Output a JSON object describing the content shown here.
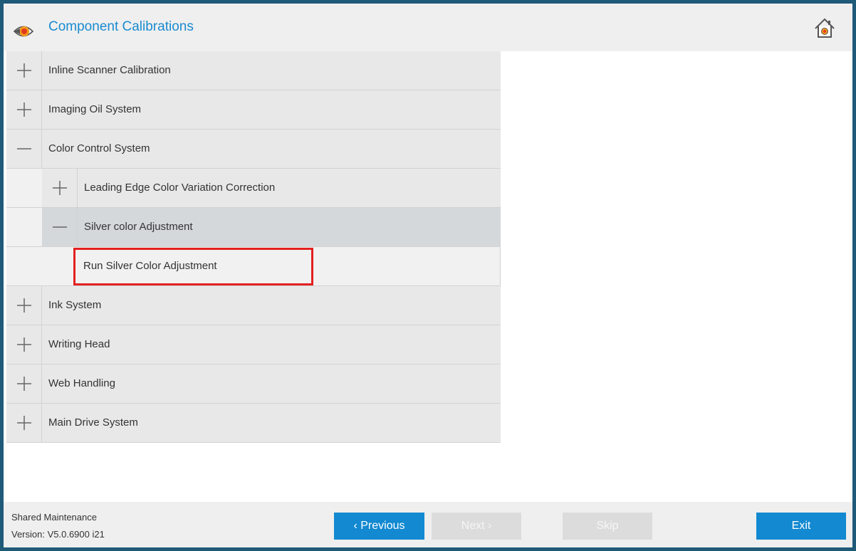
{
  "header": {
    "title": "Component Calibrations",
    "app_icon": "eye-icon",
    "home_icon": "home-icon"
  },
  "tree": {
    "items": [
      {
        "label": "Inline Scanner Calibration",
        "expanded": false
      },
      {
        "label": "Imaging Oil System",
        "expanded": false
      },
      {
        "label": "Color Control System",
        "expanded": true,
        "children": [
          {
            "label": "Leading Edge Color Variation Correction",
            "expanded": false
          },
          {
            "label": "Silver color Adjustment",
            "expanded": true,
            "selected": true,
            "children": [
              {
                "label": "Run Silver Color Adjustment"
              }
            ]
          }
        ]
      },
      {
        "label": "Ink System",
        "expanded": false
      },
      {
        "label": "Writing Head",
        "expanded": false
      },
      {
        "label": "Web Handling",
        "expanded": false
      },
      {
        "label": "Main Drive System",
        "expanded": false
      }
    ]
  },
  "footer": {
    "product": "Shared Maintenance",
    "version": "Version: V5.0.6900 i21",
    "previous_label": "‹ Previous",
    "next_label": "Next ›",
    "skip_label": "Skip",
    "exit_label": "Exit"
  },
  "colors": {
    "border": "#1f5a78",
    "accent": "#1289d1",
    "title": "#1a8bd0",
    "highlight": "#e32020"
  }
}
